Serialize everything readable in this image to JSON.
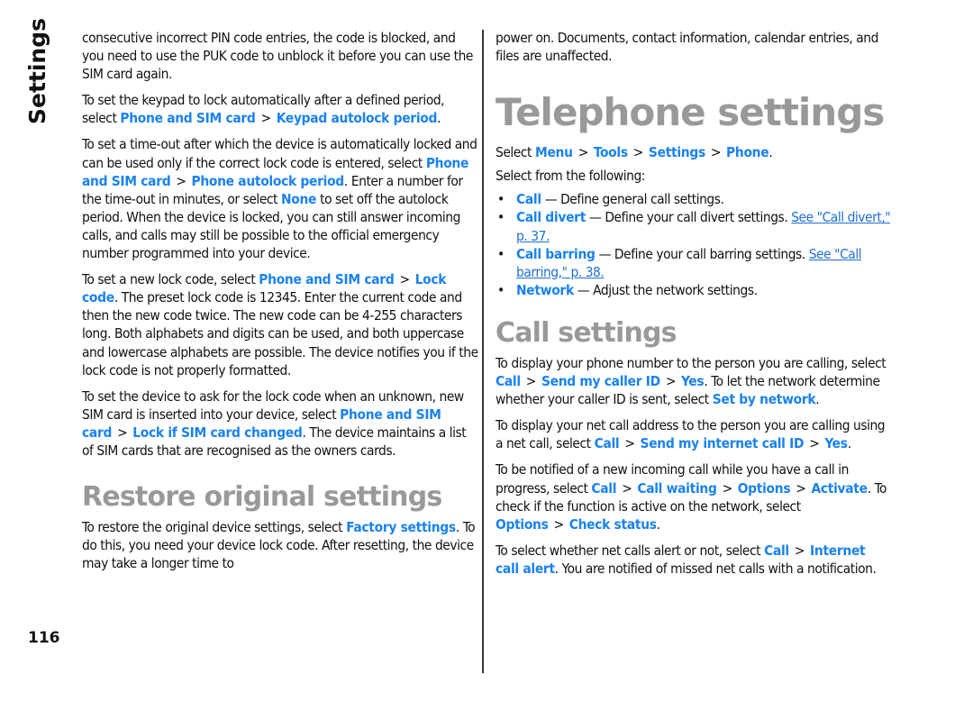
{
  "section_label": "Settings",
  "page_number": "116",
  "left": {
    "p1": "consecutive incorrect PIN code entries, the code is blocked, and you need to use the PUK code to unblock it before you can use the SIM card again.",
    "p2": {
      "pre": "To set the keypad to lock automatically after a defined period, select ",
      "path": [
        "Phone and SIM card",
        "Keypad autolock period"
      ],
      "post": "."
    },
    "p3": {
      "pre": "To set a time-out after which the device is automatically locked and can be used only if the correct lock code is entered, select ",
      "path": [
        "Phone and SIM card",
        "Phone autolock period"
      ],
      "mid": ". Enter a number for the time-out in minutes, or select ",
      "none": "None",
      "post": " to set off the autolock period. When the device is locked, you can still answer incoming calls, and calls may still be possible to the official emergency number programmed into your device."
    },
    "p4": {
      "pre": "To set a new lock code, select ",
      "path": [
        "Phone and SIM card",
        "Lock code"
      ],
      "post": ". The preset lock code is 12345. Enter the current code and then the new code twice. The new code can be 4-255 characters long. Both alphabets and digits can be used, and both uppercase and lowercase alphabets are possible. The device notifies you if the lock code is not properly formatted."
    },
    "p5": {
      "pre": "To set the device to ask for the lock code when an unknown, new SIM card is inserted into your device, select ",
      "path": [
        "Phone and SIM card",
        "Lock if SIM card changed"
      ],
      "post": ". The device maintains a list of SIM cards that are recognised as the owners cards."
    },
    "restore_heading": "Restore original settings",
    "p6": {
      "pre": "To restore the original device settings, select ",
      "key": "Factory settings",
      "post": ". To do this, you need your device lock code. After resetting, the device may take a longer time to"
    }
  },
  "right": {
    "p1": "power on. Documents, contact information, calendar entries, and files are unaffected.",
    "telephone_heading": "Telephone settings",
    "select": {
      "pre": "Select ",
      "path": [
        "Menu",
        "Tools",
        "Settings",
        "Phone"
      ],
      "post": "."
    },
    "select_from": "Select from the following:",
    "separator": ">",
    "bullet": "•",
    "list": [
      {
        "key": "Call",
        "text": " — Define general call settings.",
        "xref": ""
      },
      {
        "key": "Call divert",
        "text": " — Define your call divert settings. ",
        "xref": "See \"Call divert,\" p. 37."
      },
      {
        "key": "Call barring",
        "text": " — Define your call barring settings. ",
        "xref": "See \"Call barring,\" p. 38."
      },
      {
        "key": "Network",
        "text": " — Adjust the network settings.",
        "xref": ""
      }
    ],
    "call_heading": "Call settings",
    "c1": {
      "pre": "To display your phone number to the person you are calling, select ",
      "path": [
        "Call",
        "Send my caller ID",
        "Yes"
      ],
      "mid": ". To let the network determine whether your caller ID is sent, select ",
      "key2": "Set by network",
      "post": "."
    },
    "c2": {
      "pre": "To display your net call address to the person you are calling using a net call, select ",
      "path": [
        "Call",
        "Send my internet call ID",
        "Yes"
      ],
      "post": "."
    },
    "c3": {
      "pre": "To be notified of a new incoming call while you have a call in progress, select ",
      "path": [
        "Call",
        "Call waiting",
        "Options",
        "Activate"
      ],
      "mid": ". To check if the function is active on the network, select ",
      "path2": [
        "Options",
        "Check status"
      ],
      "post": "."
    },
    "c4": {
      "pre": "To select whether net calls alert or not, select ",
      "path": [
        "Call",
        "Internet call alert"
      ],
      "post": ". You are notified of missed net calls with a notification."
    }
  },
  "colors": {
    "link": "#1a82ef",
    "xref": "#1f6fcf",
    "heading": "#999999",
    "text": "#111111"
  }
}
